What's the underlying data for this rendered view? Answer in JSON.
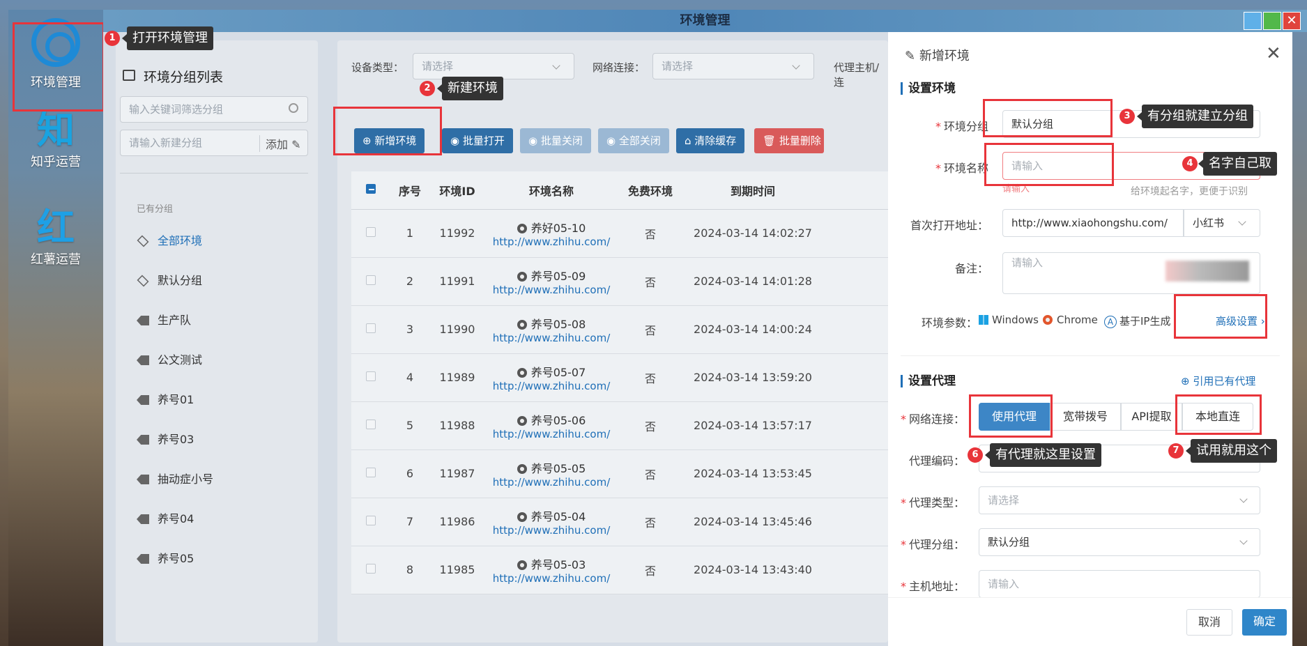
{
  "window": {
    "title": "环境管理"
  },
  "rail": {
    "items": [
      {
        "label": "环境管理",
        "glyph": ""
      },
      {
        "label": "知乎运营",
        "glyph": "知"
      },
      {
        "label": "红薯运营",
        "glyph": "红"
      }
    ]
  },
  "groups": {
    "title": "环境分组列表",
    "filter_placeholder": "输入关键词筛选分组",
    "new_placeholder": "请输入新建分组",
    "add_label": "添加",
    "section_label": "已有分组",
    "items": [
      {
        "label": "全部环境",
        "icon": "layers-icon"
      },
      {
        "label": "默认分组",
        "icon": "layers-icon"
      },
      {
        "label": "生产队",
        "icon": "tag-icon"
      },
      {
        "label": "公文测试",
        "icon": "tag-icon"
      },
      {
        "label": "养号01",
        "icon": "tag-icon"
      },
      {
        "label": "养号03",
        "icon": "tag-icon"
      },
      {
        "label": "抽动症小号",
        "icon": "tag-icon"
      },
      {
        "label": "养号04",
        "icon": "tag-icon"
      },
      {
        "label": "养号05",
        "icon": "tag-icon"
      }
    ]
  },
  "filters": {
    "device_label": "设备类型：",
    "device_placeholder": "请选择",
    "network_label": "网络连接：",
    "network_placeholder": "请选择",
    "proxy_label": "代理主机/连"
  },
  "toolbar": {
    "new": "新增环境",
    "batch_open": "批量打开",
    "batch_close": "批量关闭",
    "close_all": "全部关闭",
    "clear_cache": "清除缓存",
    "batch_delete": "批量删除"
  },
  "table": {
    "headers": [
      "",
      "序号",
      "环境ID",
      "环境名称",
      "免费环境",
      "到期时间"
    ],
    "rows": [
      {
        "no": "1",
        "id": "11992",
        "name": "养好05-10",
        "url": "http://www.zhihu.com/",
        "free": "否",
        "expire": "2024-03-14 14:02:27"
      },
      {
        "no": "2",
        "id": "11991",
        "name": "养号05-09",
        "url": "http://www.zhihu.com/",
        "free": "否",
        "expire": "2024-03-14 14:01:28"
      },
      {
        "no": "3",
        "id": "11990",
        "name": "养号05-08",
        "url": "http://www.zhihu.com/",
        "free": "否",
        "expire": "2024-03-14 14:00:24"
      },
      {
        "no": "4",
        "id": "11989",
        "name": "养号05-07",
        "url": "http://www.zhihu.com/",
        "free": "否",
        "expire": "2024-03-14 13:59:20"
      },
      {
        "no": "5",
        "id": "11988",
        "name": "养号05-06",
        "url": "http://www.zhihu.com/",
        "free": "否",
        "expire": "2024-03-14 13:57:17"
      },
      {
        "no": "6",
        "id": "11987",
        "name": "养号05-05",
        "url": "http://www.zhihu.com/",
        "free": "否",
        "expire": "2024-03-14 13:53:45"
      },
      {
        "no": "7",
        "id": "11986",
        "name": "养号05-04",
        "url": "http://www.zhihu.com/",
        "free": "否",
        "expire": "2024-03-14 13:45:46"
      },
      {
        "no": "8",
        "id": "11985",
        "name": "养号05-03",
        "url": "http://www.zhihu.com/",
        "free": "否",
        "expire": "2024-03-14 13:43:40"
      }
    ]
  },
  "drawer": {
    "title": "新增环境",
    "section_env": "设置环境",
    "group_label": "环境分组",
    "group_value": "默认分组",
    "name_label": "环境名称",
    "name_placeholder": "请输入",
    "name_error": "请输入",
    "name_hint": "给环境起名字，更便于识别",
    "url_label": "首次打开地址：",
    "url_value": "http://www.xiaohongshu.com/",
    "url_site": "小红书",
    "note_label": "备注：",
    "note_placeholder": "请输入",
    "params_label": "环境参数：",
    "param_os": "Windows",
    "param_browser": "Chrome",
    "param_ip": "基于IP生成",
    "advanced": "高级设置",
    "section_proxy": "设置代理",
    "cite_proxy": "引用已有代理",
    "network_label": "网络连接：",
    "network_options": [
      "使用代理",
      "宽带拨号",
      "API提取",
      "本地直连"
    ],
    "proxy_code_label": "代理编码：",
    "proxy_type_label": "代理类型：",
    "proxy_type_placeholder": "请选择",
    "proxy_group_label": "代理分组：",
    "proxy_group_value": "默认分组",
    "host_label": "主机地址：",
    "host_placeholder": "请输入",
    "cancel": "取消",
    "confirm": "确定"
  },
  "callouts": [
    {
      "n": "1",
      "text": "打开环境管理"
    },
    {
      "n": "2",
      "text": "新建环境"
    },
    {
      "n": "3",
      "text": "有分组就建立分组"
    },
    {
      "n": "4",
      "text": "名字自己取"
    },
    {
      "n": "6",
      "text": "有代理就这里设置"
    },
    {
      "n": "7",
      "text": "试用就用这个"
    }
  ],
  "colors": {
    "primary": "#1f6fb7",
    "danger": "#e8343a",
    "segment_active": "#3d86c6"
  }
}
